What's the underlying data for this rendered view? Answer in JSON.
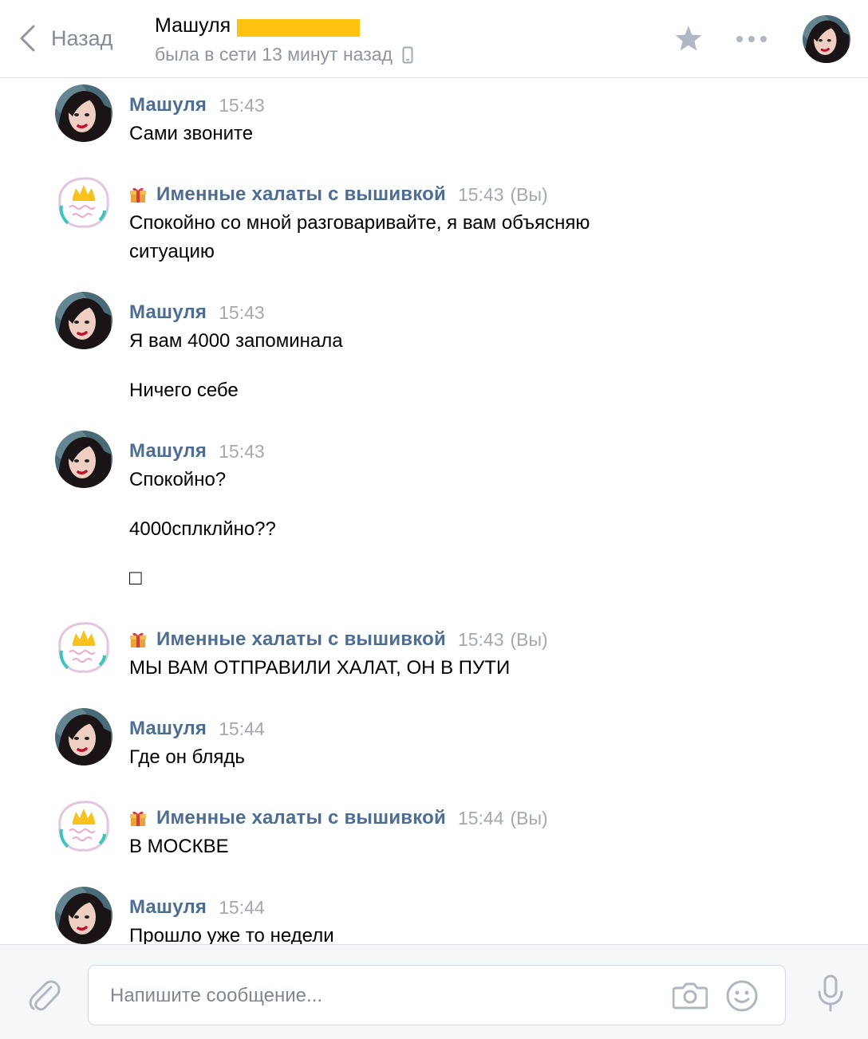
{
  "header": {
    "back_label": "Назад",
    "peer_name": "Машуля",
    "peer_status": "была в сети 13 минут назад",
    "star_icon": "star-icon",
    "more_icon": "more-icon"
  },
  "messages": [
    {
      "author": "Машуля",
      "time": "15:43",
      "you": "",
      "lines": [
        "Сами звоните"
      ]
    },
    {
      "author": "Именные халаты с вышивкой",
      "time": "15:43",
      "you": "(Вы)",
      "lines": [
        "Спокойно со мной разговаривайте, я вам объясняю",
        "ситуацию"
      ]
    },
    {
      "author": "Машуля",
      "time": "15:43",
      "you": "",
      "lines": [
        "Я вам 4000 запоминала",
        "Ничего себе"
      ]
    },
    {
      "author": "Машуля",
      "time": "15:43",
      "you": "",
      "lines": [
        "Спокойно?",
        "4000сплклйно??",
        "□"
      ]
    },
    {
      "author": "Именные халаты с вышивкой",
      "time": "15:43",
      "you": "(Вы)",
      "lines": [
        "МЫ ВАМ ОТПРАВИЛИ ХАЛАТ, ОН В ПУТИ"
      ]
    },
    {
      "author": "Машуля",
      "time": "15:44",
      "you": "",
      "lines": [
        "Где он блядь"
      ]
    },
    {
      "author": "Именные халаты с вышивкой",
      "time": "15:44",
      "you": "(Вы)",
      "lines": [
        "В МОСКВЕ"
      ]
    },
    {
      "author": "Машуля",
      "time": "15:44",
      "you": "",
      "lines": [
        "Прошло уже то недели"
      ]
    }
  ],
  "composer": {
    "placeholder": "Напишите сообщение..."
  },
  "colors": {
    "author": "#4d6d94",
    "meta": "#a3a9b0",
    "redaction": "#ffc20e"
  }
}
